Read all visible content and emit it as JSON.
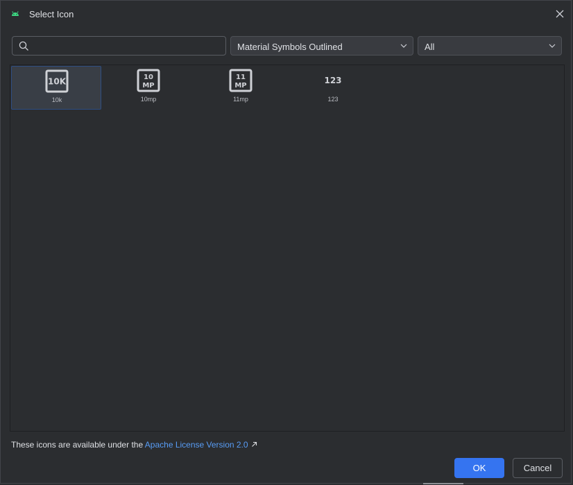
{
  "window": {
    "title": "Select Icon",
    "icon": "android-icon",
    "accent": "#3ddc84"
  },
  "search": {
    "value": "",
    "placeholder": ""
  },
  "filters": {
    "family": {
      "selected": "Material Symbols Outlined"
    },
    "category": {
      "selected": "All"
    }
  },
  "icons": [
    {
      "name": "10k",
      "icon": "10k-icon",
      "glyph_top": "10K",
      "glyph_bottom": "",
      "selected": true
    },
    {
      "name": "10mp",
      "icon": "10mp-icon",
      "glyph_top": "10",
      "glyph_bottom": "MP",
      "selected": false
    },
    {
      "name": "11mp",
      "icon": "11mp-icon",
      "glyph_top": "11",
      "glyph_bottom": "MP",
      "selected": false
    },
    {
      "name": "123",
      "icon": "123-icon",
      "glyph_top": "123",
      "glyph_bottom": "",
      "selected": false
    }
  ],
  "footer": {
    "license_prefix": "These icons are available under the ",
    "license_link": "Apache License Version 2.0"
  },
  "buttons": {
    "ok": "OK",
    "cancel": "Cancel"
  },
  "colors": {
    "background": "#2b2d30",
    "primary_button": "#3574f0",
    "link": "#589df6",
    "selection": "#393e46"
  }
}
